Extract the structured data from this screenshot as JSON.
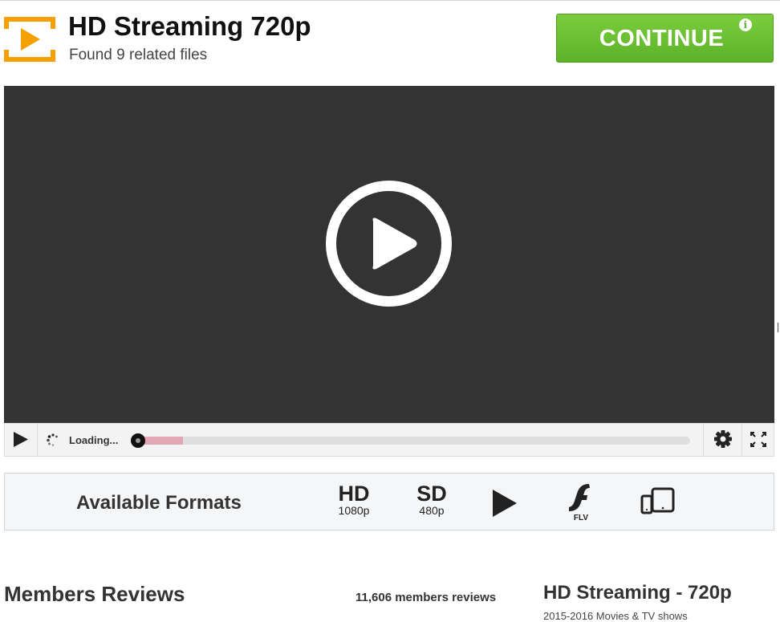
{
  "header": {
    "title": "HD Streaming 720p",
    "subtitle": "Found 9 related files",
    "logo_icon": "play-bracket-logo-icon",
    "logo_color": "#f5a000"
  },
  "continue_button": {
    "label": "CONTINUE",
    "info_glyph": "i",
    "color": "#6abf2f"
  },
  "player": {
    "background": "#333333",
    "big_play_icon": "circle-play-icon",
    "controls": {
      "play_icon": "play-icon",
      "loading_text": "Loading...",
      "buffered_fraction": 0.09,
      "played_fraction": 0,
      "settings_icon": "gear-icon",
      "fullscreen_icon": "fullscreen-icon"
    }
  },
  "formats": {
    "label": "Available Formats",
    "items": [
      {
        "big": "HD",
        "small": "1080p"
      },
      {
        "big": "SD",
        "small": "480p"
      },
      {
        "icon": "play-icon"
      },
      {
        "icon": "flash-icon",
        "small": "FLV"
      },
      {
        "icon": "mobile-tablet-icon"
      }
    ]
  },
  "reviews": {
    "title": "Members Reviews",
    "count": "11,606 members reviews"
  },
  "side": {
    "title": "HD Streaming - 720p",
    "subtitle": "2015-2016 Movies & TV shows"
  }
}
